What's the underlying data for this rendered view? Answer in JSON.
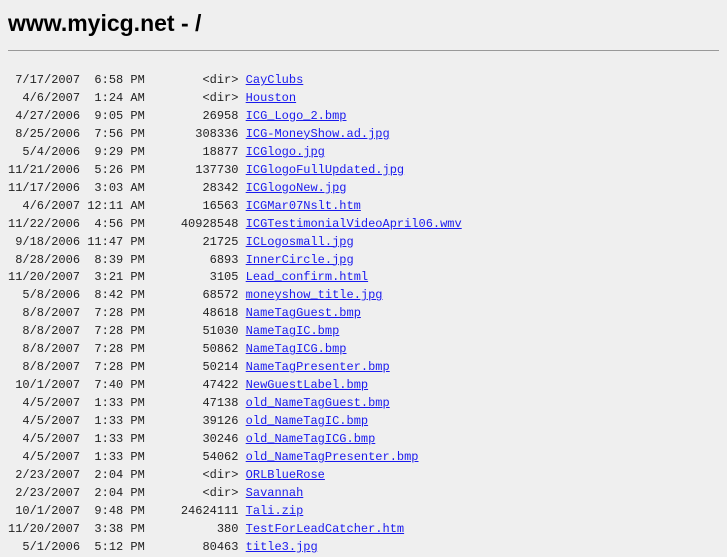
{
  "title": "www.myicg.net - /",
  "entries": [
    {
      "date": "7/17/2007",
      "time": "6:58 PM",
      "size": "<dir>",
      "name": "CayClubs"
    },
    {
      "date": "4/6/2007",
      "time": "1:24 AM",
      "size": "<dir>",
      "name": "Houston"
    },
    {
      "date": "4/27/2006",
      "time": "9:05 PM",
      "size": "26958",
      "name": "ICG_Logo_2.bmp"
    },
    {
      "date": "8/25/2006",
      "time": "7:56 PM",
      "size": "308336",
      "name": "ICG-MoneyShow.ad.jpg"
    },
    {
      "date": "5/4/2006",
      "time": "9:29 PM",
      "size": "18877",
      "name": "ICGlogo.jpg"
    },
    {
      "date": "11/21/2006",
      "time": "5:26 PM",
      "size": "137730",
      "name": "ICGlogoFullUpdated.jpg"
    },
    {
      "date": "11/17/2006",
      "time": "3:03 AM",
      "size": "28342",
      "name": "ICGlogoNew.jpg"
    },
    {
      "date": "4/6/2007",
      "time": "12:11 AM",
      "size": "16563",
      "name": "ICGMar07Nslt.htm"
    },
    {
      "date": "11/22/2006",
      "time": "4:56 PM",
      "size": "40928548",
      "name": "ICGTestimonialVideoApril06.wmv"
    },
    {
      "date": "9/18/2006",
      "time": "11:47 PM",
      "size": "21725",
      "name": "ICLogosmall.jpg"
    },
    {
      "date": "8/28/2006",
      "time": "8:39 PM",
      "size": "6893",
      "name": "InnerCircle.jpg"
    },
    {
      "date": "11/20/2007",
      "time": "3:21 PM",
      "size": "3105",
      "name": "Lead_confirm.html"
    },
    {
      "date": "5/8/2006",
      "time": "8:42 PM",
      "size": "68572",
      "name": "moneyshow_title.jpg"
    },
    {
      "date": "8/8/2007",
      "time": "7:28 PM",
      "size": "48618",
      "name": "NameTagGuest.bmp"
    },
    {
      "date": "8/8/2007",
      "time": "7:28 PM",
      "size": "51030",
      "name": "NameTagIC.bmp"
    },
    {
      "date": "8/8/2007",
      "time": "7:28 PM",
      "size": "50862",
      "name": "NameTagICG.bmp"
    },
    {
      "date": "8/8/2007",
      "time": "7:28 PM",
      "size": "50214",
      "name": "NameTagPresenter.bmp"
    },
    {
      "date": "10/1/2007",
      "time": "7:40 PM",
      "size": "47422",
      "name": "NewGuestLabel.bmp"
    },
    {
      "date": "4/5/2007",
      "time": "1:33 PM",
      "size": "47138",
      "name": "old_NameTagGuest.bmp"
    },
    {
      "date": "4/5/2007",
      "time": "1:33 PM",
      "size": "39126",
      "name": "old_NameTagIC.bmp"
    },
    {
      "date": "4/5/2007",
      "time": "1:33 PM",
      "size": "30246",
      "name": "old_NameTagICG.bmp"
    },
    {
      "date": "4/5/2007",
      "time": "1:33 PM",
      "size": "54062",
      "name": "old_NameTagPresenter.bmp"
    },
    {
      "date": "2/23/2007",
      "time": "2:04 PM",
      "size": "<dir>",
      "name": "ORLBlueRose"
    },
    {
      "date": "2/23/2007",
      "time": "2:04 PM",
      "size": "<dir>",
      "name": "Savannah"
    },
    {
      "date": "10/1/2007",
      "time": "9:48 PM",
      "size": "24624111",
      "name": "Tali.zip"
    },
    {
      "date": "11/20/2007",
      "time": "3:38 PM",
      "size": "380",
      "name": "TestForLeadCatcher.htm"
    },
    {
      "date": "5/1/2006",
      "time": "5:12 PM",
      "size": "80463",
      "name": "title3.jpg"
    }
  ]
}
